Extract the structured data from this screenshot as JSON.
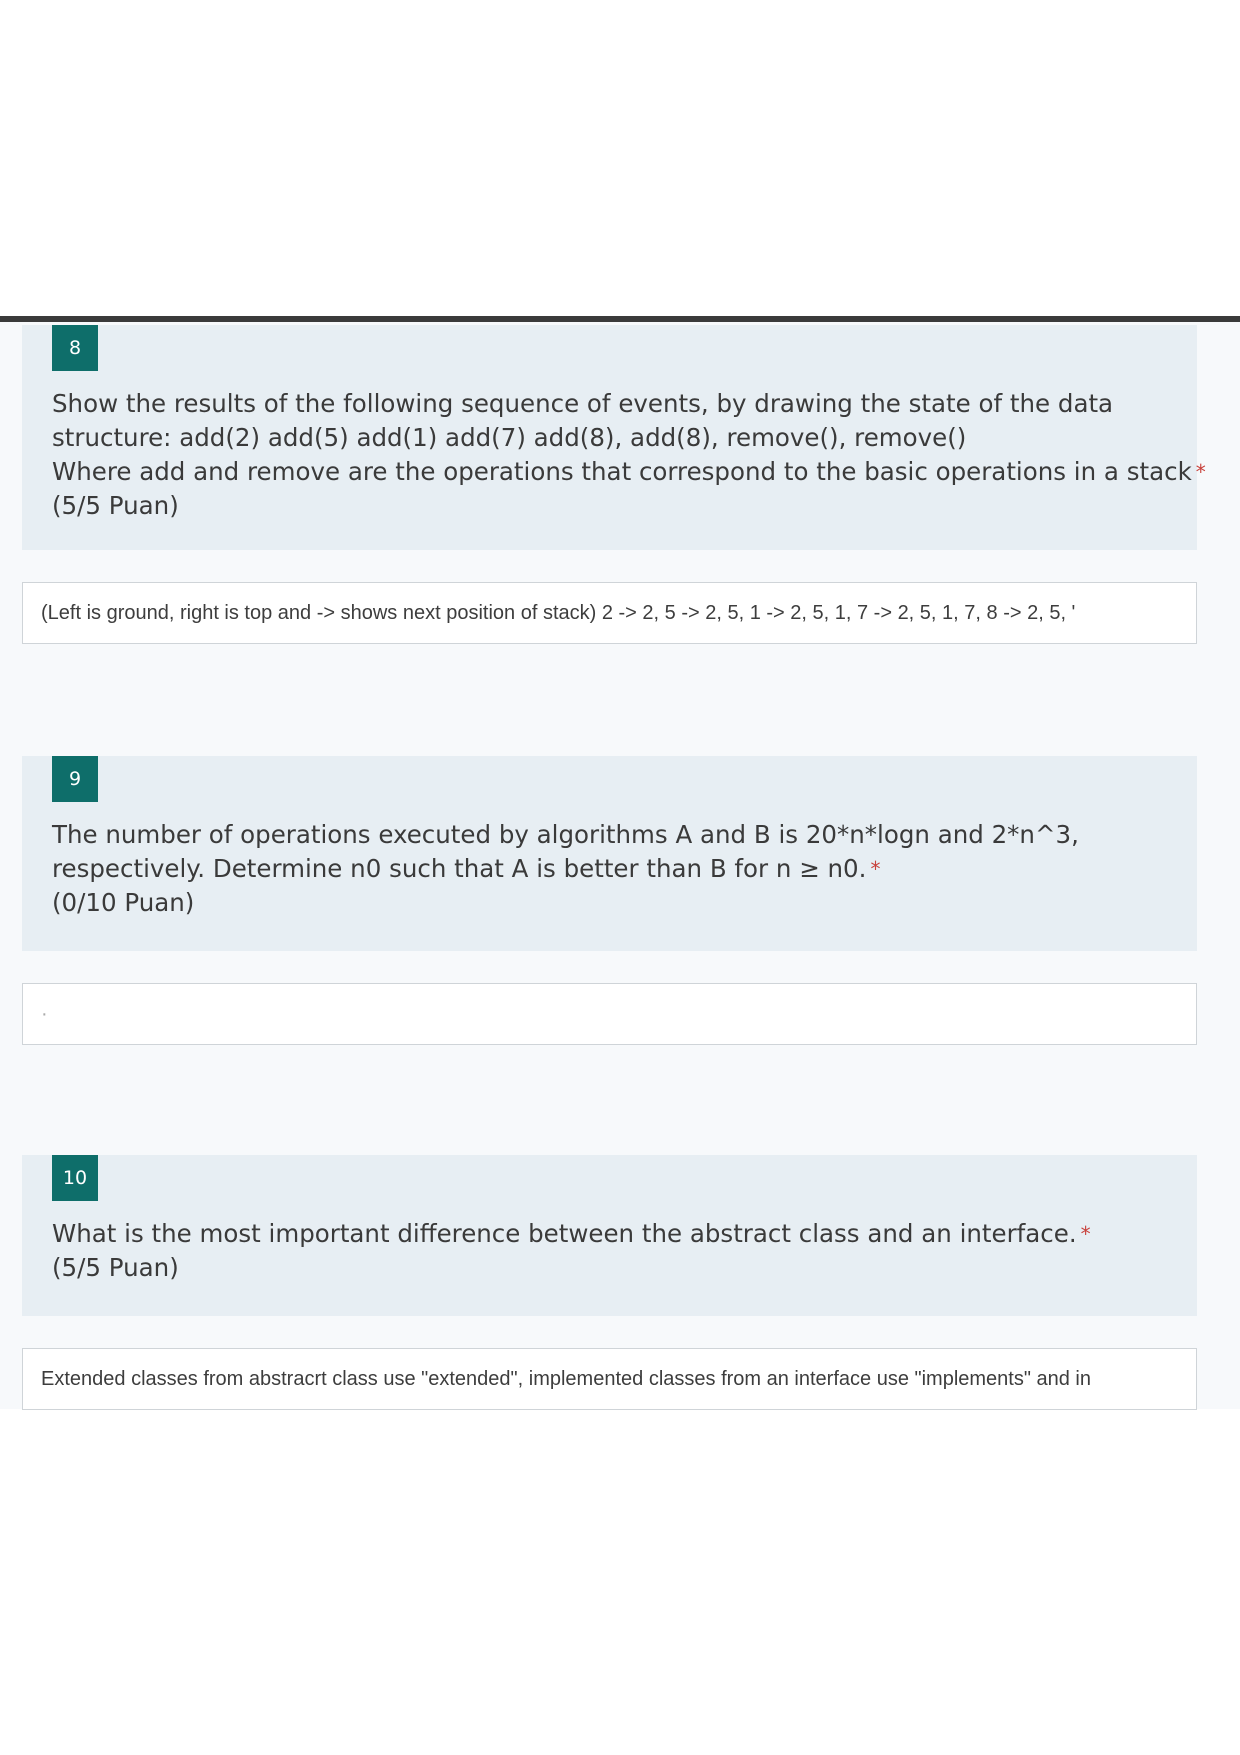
{
  "questions": [
    {
      "number": "8",
      "lines": [
        "Show the results of the following sequence of events, by drawing the state of the data",
        "structure: add(2) add(5) add(1) add(7) add(8), add(8), remove(), remove()",
        "Where add and remove are the operations that correspond to the basic operations in a stack"
      ],
      "required_mark": "*",
      "points": "(5/5 Puan)",
      "answer": "(Left is ground, right is top and -> shows next position of stack) 2 -> 2, 5 -> 2, 5, 1 -> 2, 5, 1, 7 -> 2, 5, 1, 7, 8 -> 2, 5, '"
    },
    {
      "number": "9",
      "lines": [
        "The number of operations executed by algorithms A and B is 20*n*logn and 2*n^3,",
        "respectively. Determine n0 such that A is better than B for n ≥ n0."
      ],
      "required_mark": "*",
      "points": "(0/10 Puan)",
      "answer": "·"
    },
    {
      "number": "10",
      "lines": [
        "What is the most important difference between the abstract class and an interface."
      ],
      "required_mark": "*",
      "points": "(5/5 Puan)",
      "answer": "Extended classes from abstracrt class use \"extended\", implemented classes from an interface use \"implements\" and in"
    }
  ],
  "colors": {
    "number_badge": "#0e6e6a",
    "question_bg": "#e7eef3",
    "required": "#c8413b",
    "divider": "#3a3a3a"
  }
}
